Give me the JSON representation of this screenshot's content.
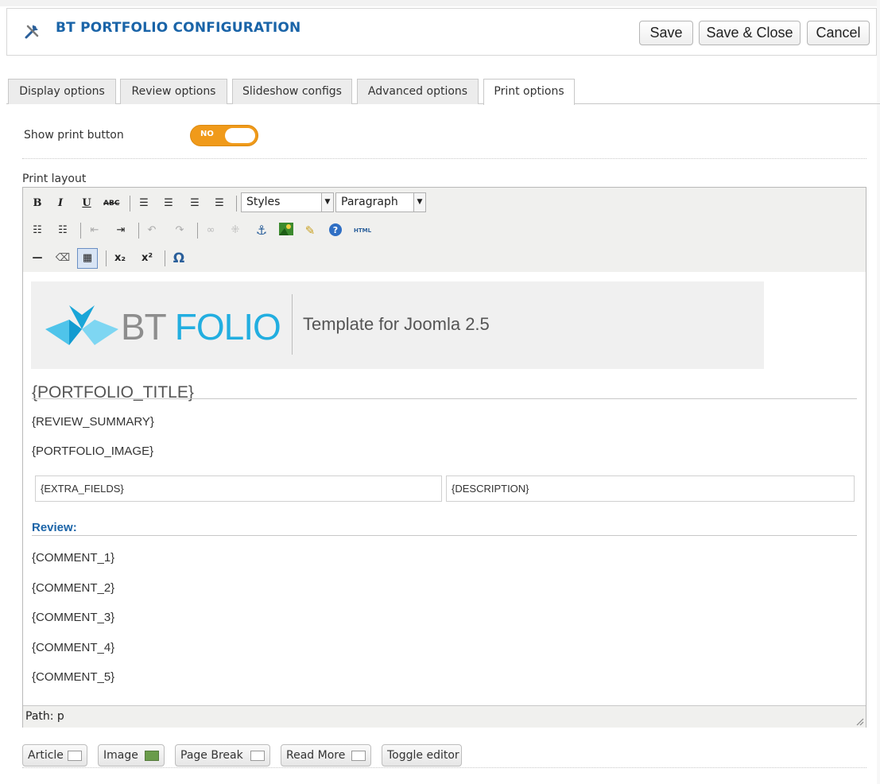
{
  "header": {
    "title": "BT PORTFOLIO CONFIGURATION",
    "save_label": "Save",
    "save_close_label": "Save & Close",
    "cancel_label": "Cancel"
  },
  "tabs": [
    {
      "label": "Display options",
      "active": false
    },
    {
      "label": "Review options",
      "active": false
    },
    {
      "label": "Slideshow configs",
      "active": false
    },
    {
      "label": "Advanced options",
      "active": false
    },
    {
      "label": "Print options",
      "active": true
    }
  ],
  "form": {
    "show_print_label": "Show print button",
    "toggle_value": "NO",
    "print_layout_label": "Print layout"
  },
  "toolbar": {
    "styles_select": "Styles",
    "format_select": "Paragraph",
    "html_label": "HTML",
    "icons": [
      "bold-icon",
      "italic-icon",
      "underline-icon",
      "strikethrough-icon",
      "align-left-icon",
      "align-center-icon",
      "align-right-icon",
      "align-justify-icon",
      "bullet-list-icon",
      "numbered-list-icon",
      "outdent-icon",
      "indent-icon",
      "undo-icon",
      "redo-icon",
      "link-icon",
      "unlink-icon",
      "anchor-icon",
      "image-icon",
      "cleanup-icon",
      "help-icon",
      "html-icon",
      "horizontal-rule-icon",
      "eraser-icon",
      "table-icon",
      "subscript-icon",
      "superscript-icon",
      "special-char-icon"
    ]
  },
  "content": {
    "banner_bt": "BT ",
    "banner_folio": "FOLIO",
    "banner_tagline": "Template for Joomla 2.5",
    "portfolio_title": "{PORTFOLIO_TITLE}",
    "review_summary": "{REVIEW_SUMMARY}",
    "portfolio_image": "{PORTFOLIO_IMAGE}",
    "extra_fields": "{EXTRA_FIELDS}",
    "description": "{DESCRIPTION}",
    "review_heading": "Review:",
    "comments": [
      "{COMMENT_1}",
      "{COMMENT_2}",
      "{COMMENT_3}",
      "{COMMENT_4}",
      "{COMMENT_5}"
    ]
  },
  "statusbar": {
    "path": "Path: p"
  },
  "bottom_buttons": [
    {
      "label": "Article"
    },
    {
      "label": "Image"
    },
    {
      "label": "Page Break"
    },
    {
      "label": "Read More"
    },
    {
      "label": "Toggle editor"
    }
  ],
  "colors": {
    "accent": "#1a64a8",
    "toggle": "#f09a1a",
    "folio": "#22aee0"
  }
}
